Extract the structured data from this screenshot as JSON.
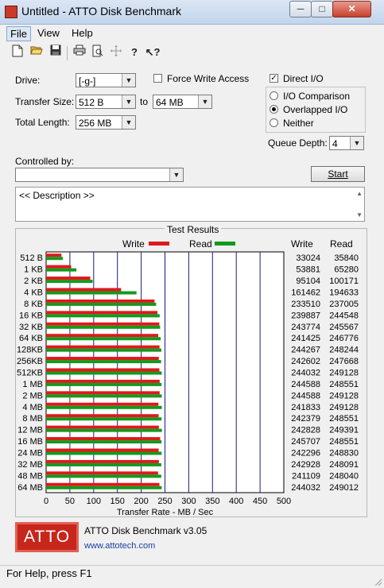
{
  "window": {
    "title": "Untitled - ATTO Disk Benchmark",
    "min": "─",
    "max": "□",
    "close": "✕"
  },
  "menu": [
    "File",
    "View",
    "Help"
  ],
  "toolbar": [
    "new-icon",
    "open-icon",
    "save-icon",
    "print-icon",
    "print-preview-icon",
    "move-icon",
    "help-icon",
    "context-help-icon"
  ],
  "form": {
    "drive_label": "Drive:",
    "drive_value": "[-g-]",
    "force_write_label": "Force Write Access",
    "force_write_checked": false,
    "direct_io_label": "Direct I/O",
    "direct_io_checked": true,
    "transfer_size_label": "Transfer Size:",
    "transfer_from": "512 B",
    "to_label": "to",
    "transfer_to": "64 MB",
    "total_length_label": "Total Length:",
    "total_length_value": "256 MB",
    "io_comparison": "I/O Comparison",
    "overlapped_io": "Overlapped I/O",
    "neither": "Neither",
    "io_mode_selected": "Overlapped I/O",
    "queue_depth_label": "Queue Depth:",
    "queue_depth_value": "4",
    "controlled_by_label": "Controlled by:",
    "controlled_by_value": "",
    "start_label": "Start",
    "description": "<< Description >>"
  },
  "results": {
    "group_title": "Test Results",
    "legend_write": "Write",
    "legend_read": "Read",
    "col_write": "Write",
    "col_read": "Read",
    "write_color": "#e0191b",
    "read_color": "#139a1d"
  },
  "chart_data": {
    "type": "bar",
    "xlabel": "Transfer Rate - MB / Sec",
    "xlim": [
      0,
      500
    ],
    "xticks": [
      0,
      50,
      100,
      150,
      200,
      250,
      300,
      350,
      400,
      450,
      500
    ],
    "categories": [
      "512 B",
      "1 KB",
      "2 KB",
      "4 KB",
      "8 KB",
      "16 KB",
      "32 KB",
      "64 KB",
      "128KB",
      "256KB",
      "512KB",
      "1 MB",
      "2 MB",
      "4 MB",
      "8 MB",
      "12 MB",
      "16 MB",
      "24 MB",
      "32 MB",
      "48 MB",
      "64 MB"
    ],
    "series": [
      {
        "name": "Write",
        "values": [
          33024,
          53881,
          95104,
          161462,
          233510,
          239887,
          243774,
          241425,
          244267,
          242602,
          244032,
          244588,
          244588,
          241833,
          242379,
          242828,
          245707,
          242296,
          242928,
          241109,
          244032
        ]
      },
      {
        "name": "Read",
        "values": [
          35840,
          65280,
          100171,
          194633,
          237005,
          244548,
          245567,
          246776,
          248244,
          247668,
          249128,
          248551,
          249128,
          249128,
          248551,
          249391,
          248551,
          248830,
          248091,
          248040,
          249012
        ]
      }
    ]
  },
  "footer": {
    "logo": "ATTO",
    "product": "ATTO Disk Benchmark v3.05",
    "url": "www.attotech.com"
  },
  "status_text": "For Help, press F1"
}
